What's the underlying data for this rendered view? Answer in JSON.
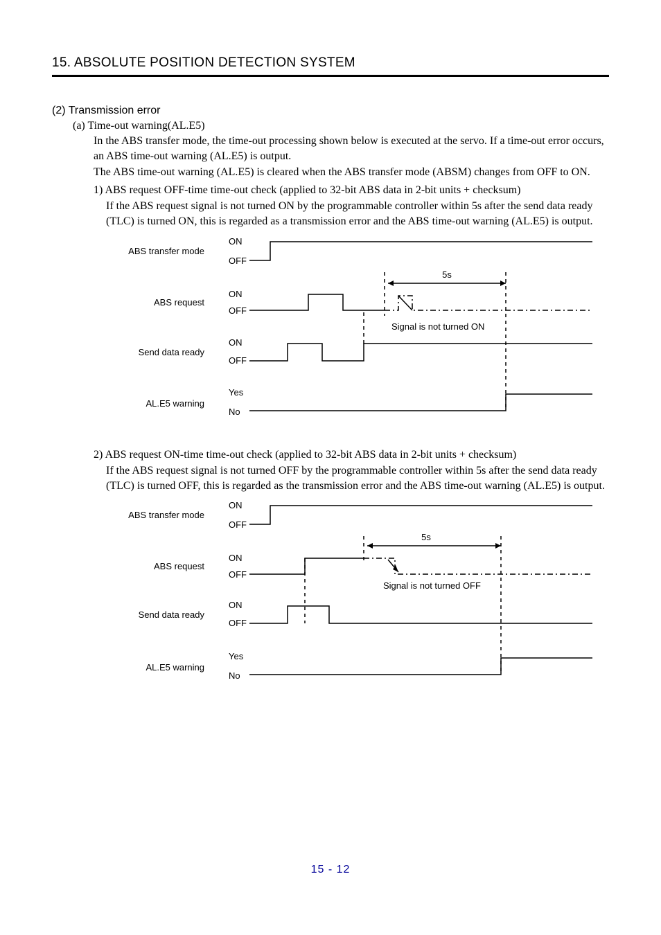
{
  "chapter": "15. ABSOLUTE POSITION DETECTION SYSTEM",
  "section_num": "(2) Transmission error",
  "sub_a": "(a) Time-out warning(AL.E5)",
  "p1": "In the ABS transfer mode, the time-out processing shown below is executed at the servo. If a time-out error occurs, an ABS time-out warning (AL.E5) is output.",
  "p2": "The ABS time-out warning (AL.E5) is cleared when the ABS transfer mode (ABSM) changes from OFF to ON.",
  "item1_head": "1) ABS request OFF-time time-out check (applied to 32-bit ABS data in 2-bit units + checksum)",
  "item1_body": "If the ABS request signal is not turned ON by the programmable controller within 5s after the send data ready (TLC) is turned ON, this is regarded as a transmission error and the ABS time-out warning (AL.E5) is output.",
  "item2_head": "2) ABS request ON-time time-out check (applied to 32-bit ABS data in 2-bit units + checksum)",
  "item2_body": "If the ABS request signal is not turned OFF by the programmable controller within 5s after the send data ready (TLC) is turned OFF, this is regarded as the transmission error and the ABS time-out warning (AL.E5) is output.",
  "diagram": {
    "abs_transfer_mode": "ABS transfer mode",
    "abs_request": "ABS request",
    "send_data_ready": "Send data ready",
    "al_e5_warning": "AL.E5 warning",
    "on": "ON",
    "off": "OFF",
    "yes": "Yes",
    "no": "No",
    "five_s": "5s",
    "signal_not_on": "Signal is not turned ON",
    "signal_not_off": "Signal is not turned OFF"
  },
  "page_number": "15 -  12"
}
